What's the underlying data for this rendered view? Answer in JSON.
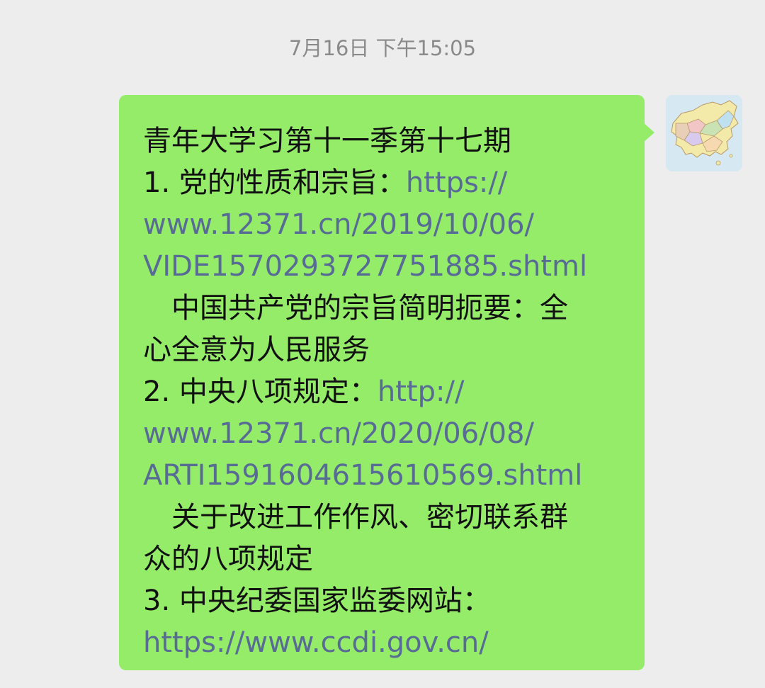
{
  "chat": {
    "timestamp": "7月16日 下午15:05",
    "avatar": {
      "icon": "china-map-icon"
    },
    "message": {
      "bubble_color": "#95ec69",
      "link_color": "#576b95",
      "title": "青年大学习第十一季第十七期",
      "item1": {
        "label": "1. 党的性质和宗旨：",
        "link_part1": "https://",
        "link_part2": "www.12371.cn/2019/10/06/",
        "link_part3": "VIDE1570293727751885.shtml",
        "desc_line1": "　中国共产党的宗旨简明扼要：全",
        "desc_line2": "心全意为人民服务"
      },
      "item2": {
        "label": "2. 中央八项规定：",
        "link_part1": "http://",
        "link_part2": "www.12371.cn/2020/06/08/",
        "link_part3": "ARTI1591604615610569.shtml",
        "desc_line1": "　关于改进工作作风、密切联系群",
        "desc_line2": "众的八项规定"
      },
      "item3": {
        "label": "3. 中央纪委国家监委网站：",
        "link": "https://www.ccdi.gov.cn/"
      }
    }
  }
}
